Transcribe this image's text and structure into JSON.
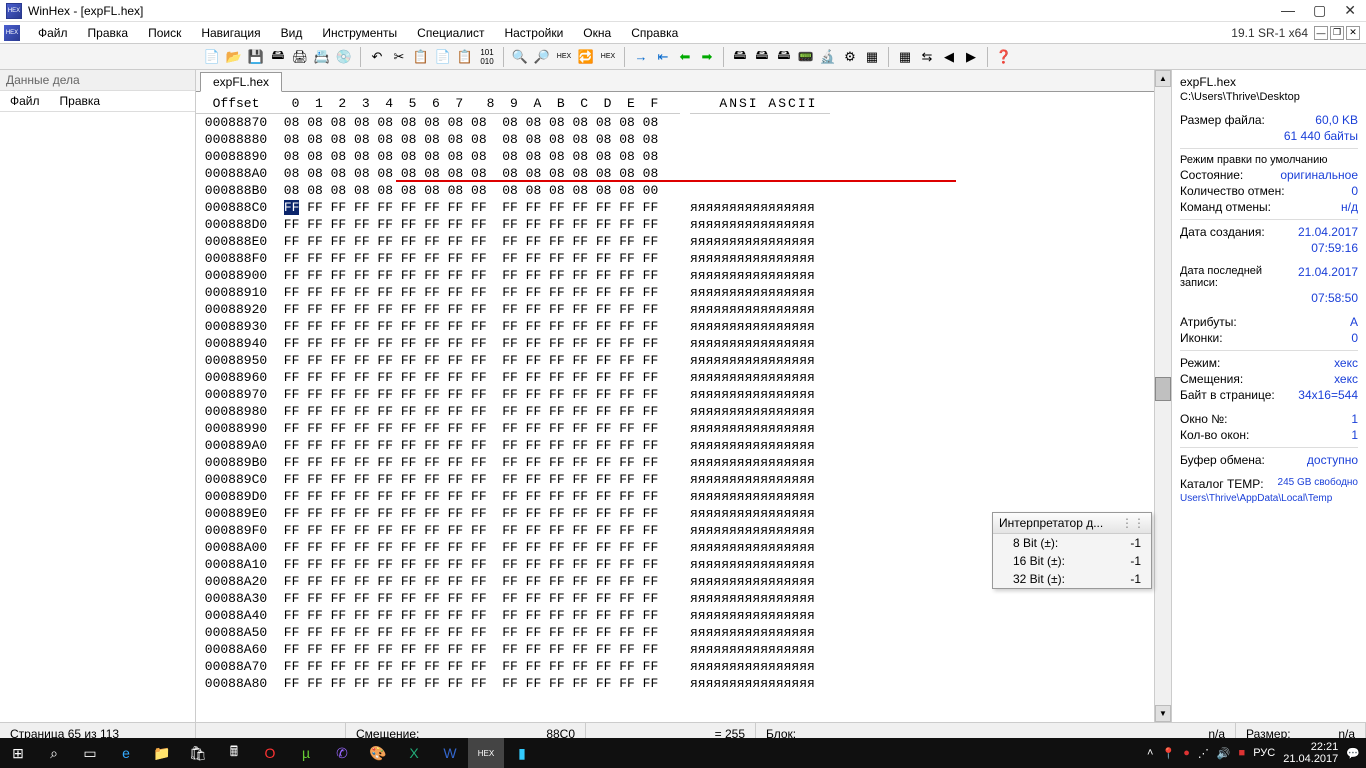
{
  "title": "WinHex - [expFL.hex]",
  "version": "19.1 SR-1 x64",
  "menus": [
    "Файл",
    "Правка",
    "Поиск",
    "Навигация",
    "Вид",
    "Инструменты",
    "Специалист",
    "Настройки",
    "Окна",
    "Справка"
  ],
  "leftpane": {
    "header": "Данные дела",
    "submenu": [
      "Файл",
      "Правка"
    ]
  },
  "tab": "expFL.hex",
  "hexheader": {
    "offset": "Offset",
    "cols": [
      "0",
      "1",
      "2",
      "3",
      "4",
      "5",
      "6",
      "7",
      "8",
      "9",
      "A",
      "B",
      "C",
      "D",
      "E",
      "F"
    ],
    "ascii": "ANSI ASCII"
  },
  "rows": [
    {
      "off": "00088870",
      "b": [
        "08",
        "08",
        "08",
        "08",
        "08",
        "08",
        "08",
        "08",
        "08",
        "08",
        "08",
        "08",
        "08",
        "08",
        "08",
        "08"
      ],
      "a": "                "
    },
    {
      "off": "00088880",
      "b": [
        "08",
        "08",
        "08",
        "08",
        "08",
        "08",
        "08",
        "08",
        "08",
        "08",
        "08",
        "08",
        "08",
        "08",
        "08",
        "08"
      ],
      "a": "                "
    },
    {
      "off": "00088890",
      "b": [
        "08",
        "08",
        "08",
        "08",
        "08",
        "08",
        "08",
        "08",
        "08",
        "08",
        "08",
        "08",
        "08",
        "08",
        "08",
        "08"
      ],
      "a": "                "
    },
    {
      "off": "000888A0",
      "b": [
        "08",
        "08",
        "08",
        "08",
        "08",
        "08",
        "08",
        "08",
        "08",
        "08",
        "08",
        "08",
        "08",
        "08",
        "08",
        "08"
      ],
      "a": "                "
    },
    {
      "off": "000888B0",
      "b": [
        "08",
        "08",
        "08",
        "08",
        "08",
        "08",
        "08",
        "08",
        "08",
        "08",
        "08",
        "08",
        "08",
        "08",
        "08",
        "00"
      ],
      "a": "                "
    },
    {
      "off": "000888C0",
      "b": [
        "FF",
        "FF",
        "FF",
        "FF",
        "FF",
        "FF",
        "FF",
        "FF",
        "FF",
        "FF",
        "FF",
        "FF",
        "FF",
        "FF",
        "FF",
        "FF"
      ],
      "a": "яяяяяяяяяяяяяяяя",
      "sel": 0
    },
    {
      "off": "000888D0",
      "b": [
        "FF",
        "FF",
        "FF",
        "FF",
        "FF",
        "FF",
        "FF",
        "FF",
        "FF",
        "FF",
        "FF",
        "FF",
        "FF",
        "FF",
        "FF",
        "FF"
      ],
      "a": "яяяяяяяяяяяяяяяя"
    },
    {
      "off": "000888E0",
      "b": [
        "FF",
        "FF",
        "FF",
        "FF",
        "FF",
        "FF",
        "FF",
        "FF",
        "FF",
        "FF",
        "FF",
        "FF",
        "FF",
        "FF",
        "FF",
        "FF"
      ],
      "a": "яяяяяяяяяяяяяяяя"
    },
    {
      "off": "000888F0",
      "b": [
        "FF",
        "FF",
        "FF",
        "FF",
        "FF",
        "FF",
        "FF",
        "FF",
        "FF",
        "FF",
        "FF",
        "FF",
        "FF",
        "FF",
        "FF",
        "FF"
      ],
      "a": "яяяяяяяяяяяяяяяя"
    },
    {
      "off": "00088900",
      "b": [
        "FF",
        "FF",
        "FF",
        "FF",
        "FF",
        "FF",
        "FF",
        "FF",
        "FF",
        "FF",
        "FF",
        "FF",
        "FF",
        "FF",
        "FF",
        "FF"
      ],
      "a": "яяяяяяяяяяяяяяяя"
    },
    {
      "off": "00088910",
      "b": [
        "FF",
        "FF",
        "FF",
        "FF",
        "FF",
        "FF",
        "FF",
        "FF",
        "FF",
        "FF",
        "FF",
        "FF",
        "FF",
        "FF",
        "FF",
        "FF"
      ],
      "a": "яяяяяяяяяяяяяяяя"
    },
    {
      "off": "00088920",
      "b": [
        "FF",
        "FF",
        "FF",
        "FF",
        "FF",
        "FF",
        "FF",
        "FF",
        "FF",
        "FF",
        "FF",
        "FF",
        "FF",
        "FF",
        "FF",
        "FF"
      ],
      "a": "яяяяяяяяяяяяяяяя"
    },
    {
      "off": "00088930",
      "b": [
        "FF",
        "FF",
        "FF",
        "FF",
        "FF",
        "FF",
        "FF",
        "FF",
        "FF",
        "FF",
        "FF",
        "FF",
        "FF",
        "FF",
        "FF",
        "FF"
      ],
      "a": "яяяяяяяяяяяяяяяя"
    },
    {
      "off": "00088940",
      "b": [
        "FF",
        "FF",
        "FF",
        "FF",
        "FF",
        "FF",
        "FF",
        "FF",
        "FF",
        "FF",
        "FF",
        "FF",
        "FF",
        "FF",
        "FF",
        "FF"
      ],
      "a": "яяяяяяяяяяяяяяяя"
    },
    {
      "off": "00088950",
      "b": [
        "FF",
        "FF",
        "FF",
        "FF",
        "FF",
        "FF",
        "FF",
        "FF",
        "FF",
        "FF",
        "FF",
        "FF",
        "FF",
        "FF",
        "FF",
        "FF"
      ],
      "a": "яяяяяяяяяяяяяяяя"
    },
    {
      "off": "00088960",
      "b": [
        "FF",
        "FF",
        "FF",
        "FF",
        "FF",
        "FF",
        "FF",
        "FF",
        "FF",
        "FF",
        "FF",
        "FF",
        "FF",
        "FF",
        "FF",
        "FF"
      ],
      "a": "яяяяяяяяяяяяяяяя"
    },
    {
      "off": "00088970",
      "b": [
        "FF",
        "FF",
        "FF",
        "FF",
        "FF",
        "FF",
        "FF",
        "FF",
        "FF",
        "FF",
        "FF",
        "FF",
        "FF",
        "FF",
        "FF",
        "FF"
      ],
      "a": "яяяяяяяяяяяяяяяя"
    },
    {
      "off": "00088980",
      "b": [
        "FF",
        "FF",
        "FF",
        "FF",
        "FF",
        "FF",
        "FF",
        "FF",
        "FF",
        "FF",
        "FF",
        "FF",
        "FF",
        "FF",
        "FF",
        "FF"
      ],
      "a": "яяяяяяяяяяяяяяяя"
    },
    {
      "off": "00088990",
      "b": [
        "FF",
        "FF",
        "FF",
        "FF",
        "FF",
        "FF",
        "FF",
        "FF",
        "FF",
        "FF",
        "FF",
        "FF",
        "FF",
        "FF",
        "FF",
        "FF"
      ],
      "a": "яяяяяяяяяяяяяяяя"
    },
    {
      "off": "000889A0",
      "b": [
        "FF",
        "FF",
        "FF",
        "FF",
        "FF",
        "FF",
        "FF",
        "FF",
        "FF",
        "FF",
        "FF",
        "FF",
        "FF",
        "FF",
        "FF",
        "FF"
      ],
      "a": "яяяяяяяяяяяяяяяя"
    },
    {
      "off": "000889B0",
      "b": [
        "FF",
        "FF",
        "FF",
        "FF",
        "FF",
        "FF",
        "FF",
        "FF",
        "FF",
        "FF",
        "FF",
        "FF",
        "FF",
        "FF",
        "FF",
        "FF"
      ],
      "a": "яяяяяяяяяяяяяяяя"
    },
    {
      "off": "000889C0",
      "b": [
        "FF",
        "FF",
        "FF",
        "FF",
        "FF",
        "FF",
        "FF",
        "FF",
        "FF",
        "FF",
        "FF",
        "FF",
        "FF",
        "FF",
        "FF",
        "FF"
      ],
      "a": "яяяяяяяяяяяяяяяя"
    },
    {
      "off": "000889D0",
      "b": [
        "FF",
        "FF",
        "FF",
        "FF",
        "FF",
        "FF",
        "FF",
        "FF",
        "FF",
        "FF",
        "FF",
        "FF",
        "FF",
        "FF",
        "FF",
        "FF"
      ],
      "a": "яяяяяяяяяяяяяяяя"
    },
    {
      "off": "000889E0",
      "b": [
        "FF",
        "FF",
        "FF",
        "FF",
        "FF",
        "FF",
        "FF",
        "FF",
        "FF",
        "FF",
        "FF",
        "FF",
        "FF",
        "FF",
        "FF",
        "FF"
      ],
      "a": "яяяяяяяяяяяяяяяя"
    },
    {
      "off": "000889F0",
      "b": [
        "FF",
        "FF",
        "FF",
        "FF",
        "FF",
        "FF",
        "FF",
        "FF",
        "FF",
        "FF",
        "FF",
        "FF",
        "FF",
        "FF",
        "FF",
        "FF"
      ],
      "a": "яяяяяяяяяяяяяяяя"
    },
    {
      "off": "00088A00",
      "b": [
        "FF",
        "FF",
        "FF",
        "FF",
        "FF",
        "FF",
        "FF",
        "FF",
        "FF",
        "FF",
        "FF",
        "FF",
        "FF",
        "FF",
        "FF",
        "FF"
      ],
      "a": "яяяяяяяяяяяяяяяя"
    },
    {
      "off": "00088A10",
      "b": [
        "FF",
        "FF",
        "FF",
        "FF",
        "FF",
        "FF",
        "FF",
        "FF",
        "FF",
        "FF",
        "FF",
        "FF",
        "FF",
        "FF",
        "FF",
        "FF"
      ],
      "a": "яяяяяяяяяяяяяяяя"
    },
    {
      "off": "00088A20",
      "b": [
        "FF",
        "FF",
        "FF",
        "FF",
        "FF",
        "FF",
        "FF",
        "FF",
        "FF",
        "FF",
        "FF",
        "FF",
        "FF",
        "FF",
        "FF",
        "FF"
      ],
      "a": "яяяяяяяяяяяяяяяя"
    },
    {
      "off": "00088A30",
      "b": [
        "FF",
        "FF",
        "FF",
        "FF",
        "FF",
        "FF",
        "FF",
        "FF",
        "FF",
        "FF",
        "FF",
        "FF",
        "FF",
        "FF",
        "FF",
        "FF"
      ],
      "a": "яяяяяяяяяяяяяяяя"
    },
    {
      "off": "00088A40",
      "b": [
        "FF",
        "FF",
        "FF",
        "FF",
        "FF",
        "FF",
        "FF",
        "FF",
        "FF",
        "FF",
        "FF",
        "FF",
        "FF",
        "FF",
        "FF",
        "FF"
      ],
      "a": "яяяяяяяяяяяяяяяя"
    },
    {
      "off": "00088A50",
      "b": [
        "FF",
        "FF",
        "FF",
        "FF",
        "FF",
        "FF",
        "FF",
        "FF",
        "FF",
        "FF",
        "FF",
        "FF",
        "FF",
        "FF",
        "FF",
        "FF"
      ],
      "a": "яяяяяяяяяяяяяяяя"
    },
    {
      "off": "00088A60",
      "b": [
        "FF",
        "FF",
        "FF",
        "FF",
        "FF",
        "FF",
        "FF",
        "FF",
        "FF",
        "FF",
        "FF",
        "FF",
        "FF",
        "FF",
        "FF",
        "FF"
      ],
      "a": "яяяяяяяяяяяяяяяя"
    },
    {
      "off": "00088A70",
      "b": [
        "FF",
        "FF",
        "FF",
        "FF",
        "FF",
        "FF",
        "FF",
        "FF",
        "FF",
        "FF",
        "FF",
        "FF",
        "FF",
        "FF",
        "FF",
        "FF"
      ],
      "a": "яяяяяяяяяяяяяяяя"
    },
    {
      "off": "00088A80",
      "b": [
        "FF",
        "FF",
        "FF",
        "FF",
        "FF",
        "FF",
        "FF",
        "FF",
        "FF",
        "FF",
        "FF",
        "FF",
        "FF",
        "FF",
        "FF",
        "FF"
      ],
      "a": "яяяяяяяяяяяяяяяя"
    }
  ],
  "info": {
    "filename": "expFL.hex",
    "path": "C:\\Users\\Thrive\\Desktop",
    "size_label": "Размер файла:",
    "size": "60,0 KB",
    "bytes": "61 440 байты",
    "editlabel": "Режим правки по умолчанию",
    "state_label": "Состояние:",
    "state": "оригинальное",
    "undocount_label": "Количество отмен:",
    "undocount": "0",
    "undocmd_label": "Команд отмены:",
    "undocmd": "н/д",
    "created_label": "Дата создания:",
    "created": "21.04.2017",
    "created_time": "07:59:16",
    "modified_label": "Дата последней записи:",
    "modified": "21.04.2017",
    "modified_time": "07:58:50",
    "attr_label": "Атрибуты:",
    "attr": "A",
    "icons_label": "Иконки:",
    "icons": "0",
    "mode_label": "Режим:",
    "mode": "хекс",
    "offsets_label": "Смещения:",
    "offsets": "хекс",
    "bpp_label": "Байт в странице:",
    "bpp": "34x16=544",
    "winno_label": "Окно №:",
    "winno": "1",
    "wincount_label": "Кол-во окон:",
    "wincount": "1",
    "clip_label": "Буфер обмена:",
    "clip": "доступно",
    "temp_label": "Каталог TEMP:",
    "temp": "245 GB свободно",
    "temp_path": "Users\\Thrive\\AppData\\Local\\Temp"
  },
  "interp": {
    "title": "Интерпретатор д...",
    "rows": [
      [
        "8 Bit (±):",
        "-1"
      ],
      [
        "16 Bit (±):",
        "-1"
      ],
      [
        "32 Bit (±):",
        "-1"
      ]
    ]
  },
  "status": {
    "page": "Страница 65 из 113",
    "offset_label": "Смещение:",
    "offset": "88C0",
    "val": "= 255",
    "block": "Блок:",
    "block_val": "n/a",
    "size_label": "Размер:",
    "size_val": "n/a"
  },
  "taskbar": {
    "time": "22:21",
    "date": "21.04.2017",
    "lang": "РУС"
  }
}
